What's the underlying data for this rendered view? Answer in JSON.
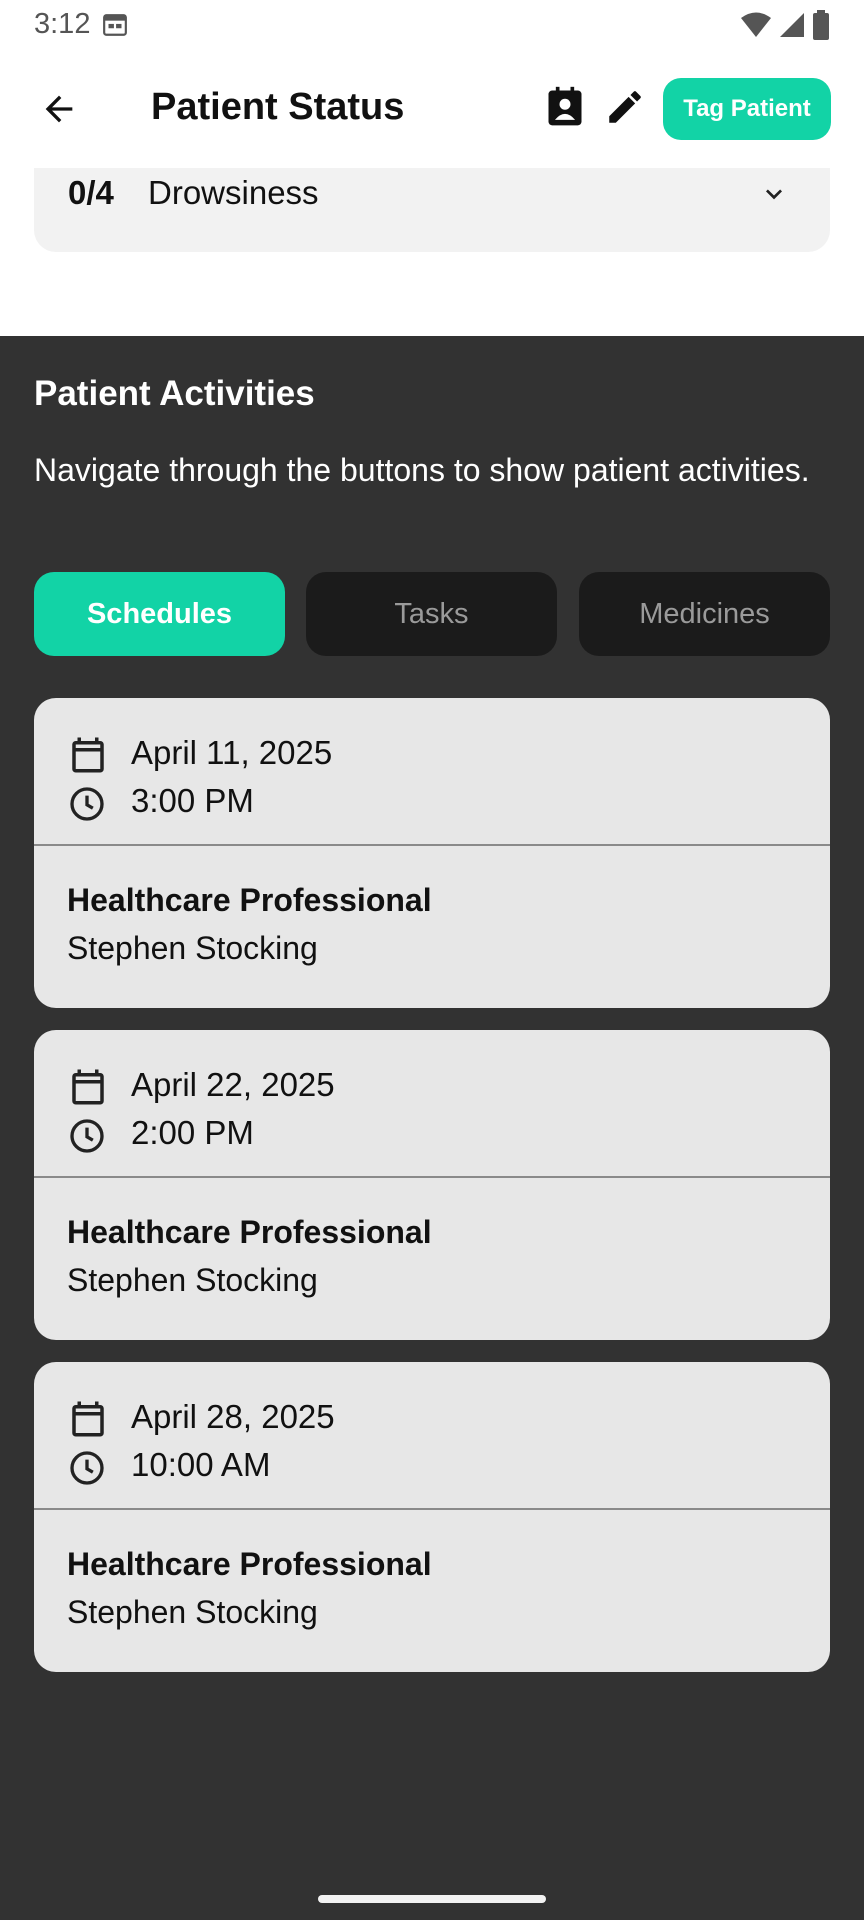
{
  "status_bar": {
    "time": "3:12"
  },
  "app_bar": {
    "title": "Patient Status",
    "tag_button": "Tag Patient"
  },
  "symptom": {
    "score": "0/4",
    "name": "Drowsiness"
  },
  "activities": {
    "title": "Patient Activities",
    "description": "Navigate through the buttons to show patient activities.",
    "tabs": [
      {
        "label": "Schedules",
        "active": true
      },
      {
        "label": "Tasks",
        "active": false
      },
      {
        "label": "Medicines",
        "active": false
      }
    ],
    "schedules": [
      {
        "date": "April 11, 2025",
        "time": "3:00 PM",
        "role": "Healthcare Professional",
        "name": "Stephen Stocking"
      },
      {
        "date": "April 22, 2025",
        "time": "2:00 PM",
        "role": "Healthcare Professional",
        "name": "Stephen Stocking"
      },
      {
        "date": "April 28, 2025",
        "time": "10:00 AM",
        "role": "Healthcare Professional",
        "name": "Stephen Stocking"
      }
    ]
  },
  "colors": {
    "accent": "#12d3a6",
    "dark_bg": "#323232",
    "card_bg": "#e7e7e7"
  },
  "icons": [
    "calendar-status-icon",
    "wifi-icon",
    "signal-icon",
    "battery-icon",
    "back-arrow-icon",
    "contact-card-icon",
    "pencil-icon",
    "chevron-down-icon",
    "calendar-icon",
    "clock-icon"
  ]
}
